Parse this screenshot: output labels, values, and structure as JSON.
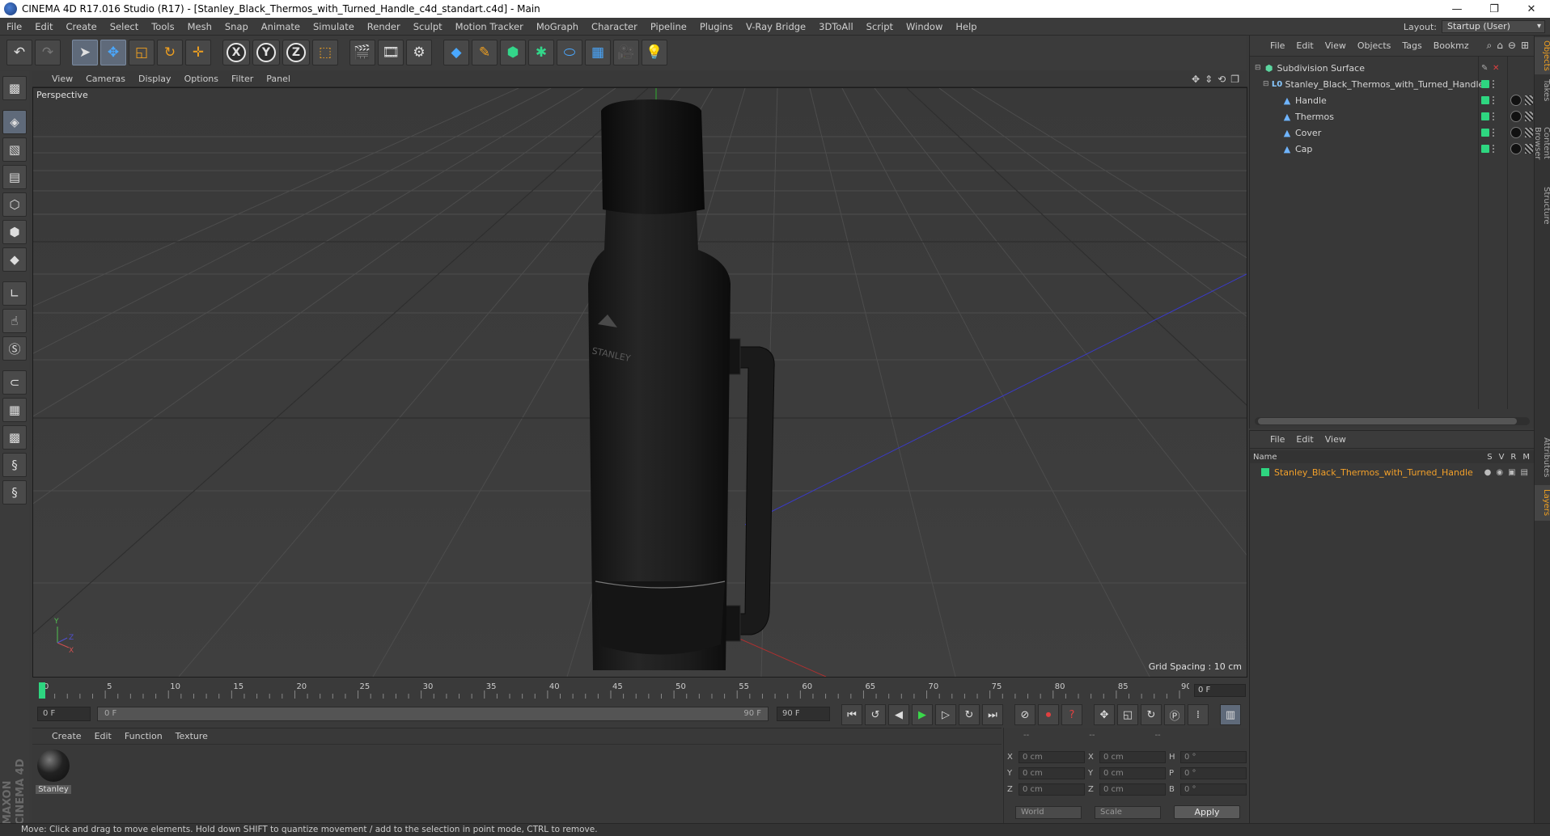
{
  "window": {
    "title": "CINEMA 4D R17.016 Studio (R17) - [Stanley_Black_Thermos_with_Turned_Handle_c4d_standart.c4d] - Main",
    "minimize": "—",
    "maximize": "❐",
    "close": "✕"
  },
  "menu": [
    "File",
    "Edit",
    "Create",
    "Select",
    "Tools",
    "Mesh",
    "Snap",
    "Animate",
    "Simulate",
    "Render",
    "Sculpt",
    "Motion Tracker",
    "MoGraph",
    "Character",
    "Pipeline",
    "Plugins",
    "V-Ray Bridge",
    "3DToAll",
    "Script",
    "Window",
    "Help"
  ],
  "layout": {
    "label": "Layout:",
    "value": "Startup (User)"
  },
  "viewport": {
    "menu": [
      "View",
      "Cameras",
      "Display",
      "Options",
      "Filter",
      "Panel"
    ],
    "label": "Perspective",
    "grid_spacing": "Grid Spacing : 10 cm"
  },
  "timeline": {
    "ticks": [
      "0",
      "5",
      "10",
      "15",
      "20",
      "25",
      "30",
      "35",
      "40",
      "45",
      "50",
      "55",
      "60",
      "65",
      "70",
      "75",
      "80",
      "85",
      "90"
    ],
    "current_frame": "0 F"
  },
  "transport": {
    "start": "0 F",
    "range_start": "0 F",
    "range_end": "90 F",
    "end": "90 F"
  },
  "materials": {
    "menu": [
      "Create",
      "Edit",
      "Function",
      "Texture"
    ],
    "items": [
      {
        "name": "Stanley"
      }
    ]
  },
  "coordinates": {
    "header": [
      "--",
      "--",
      "--"
    ],
    "rows": [
      {
        "a": "X",
        "av": "0 cm",
        "b": "X",
        "bv": "0 cm",
        "c": "H",
        "cv": "0 °"
      },
      {
        "a": "Y",
        "av": "0 cm",
        "b": "Y",
        "bv": "0 cm",
        "c": "P",
        "cv": "0 °"
      },
      {
        "a": "Z",
        "av": "0 cm",
        "b": "Z",
        "bv": "0 cm",
        "c": "B",
        "cv": "0 °"
      }
    ],
    "mode": "World",
    "type": "Scale",
    "apply": "Apply"
  },
  "status": "Move: Click and drag to move elements. Hold down SHIFT to quantize movement / add to the selection in point mode, CTRL to remove.",
  "objects": {
    "menu": [
      "File",
      "Edit",
      "View",
      "Objects",
      "Tags",
      "Bookmz"
    ],
    "tree": [
      {
        "name": "Subdivision Surface",
        "icon": "subdivision-icon"
      },
      {
        "name": "Stanley_Black_Thermos_with_Turned_Handle",
        "icon": "null-icon"
      },
      {
        "name": "Handle",
        "icon": "polygon-icon"
      },
      {
        "name": "Thermos",
        "icon": "polygon-icon"
      },
      {
        "name": "Cover",
        "icon": "polygon-icon"
      },
      {
        "name": "Cap",
        "icon": "polygon-icon"
      }
    ]
  },
  "layers": {
    "menu": [
      "File",
      "Edit",
      "View"
    ],
    "header": {
      "name": "Name",
      "cols": [
        "S",
        "V",
        "R",
        "M"
      ]
    },
    "rows": [
      {
        "name": "Stanley_Black_Thermos_with_Turned_Handle",
        "color": "#2ed680"
      }
    ]
  },
  "side_tabs": [
    "Objects",
    "Takes",
    "Content Browser",
    "Structure",
    "Attributes",
    "Layers"
  ],
  "colors": {
    "accent": "#f0a020",
    "layer_green": "#2ed680",
    "selection_blue": "#5f6a7a"
  }
}
